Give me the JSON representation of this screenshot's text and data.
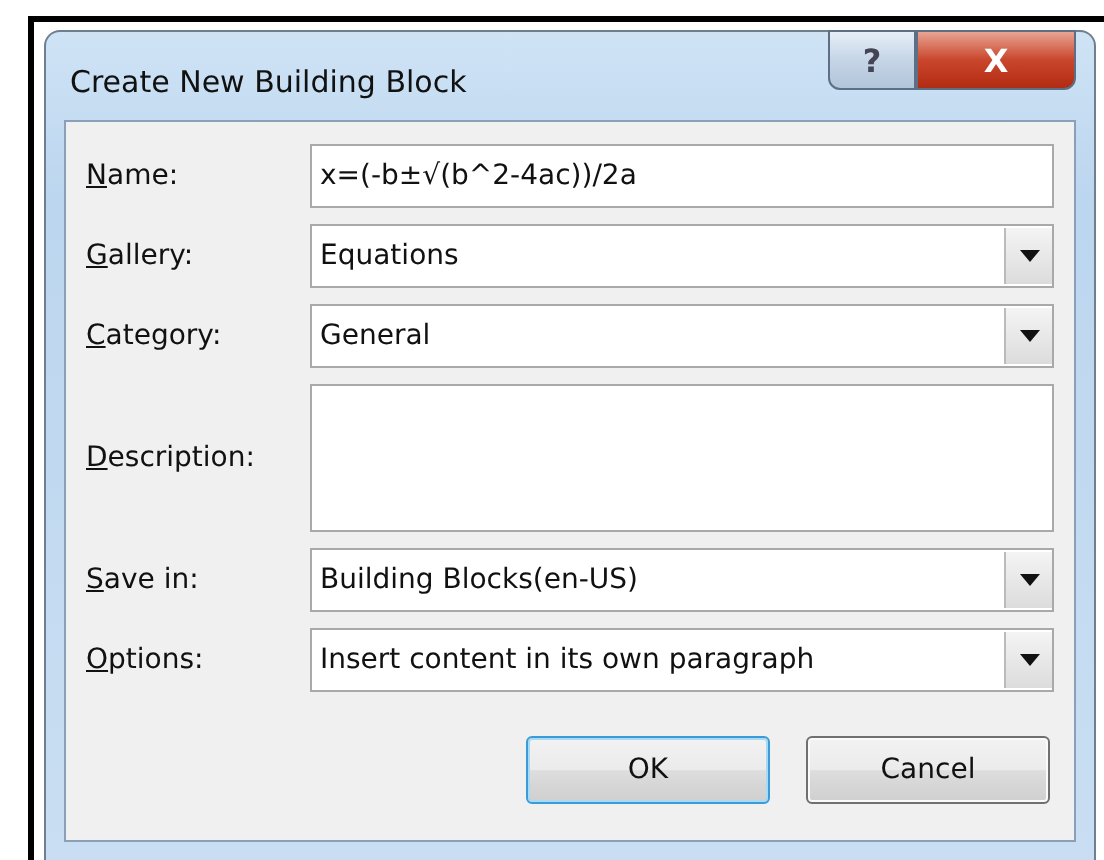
{
  "window": {
    "title": "Create New Building Block",
    "help": "?",
    "close": "X"
  },
  "fields": [
    {
      "label": "Name:",
      "kind": "text",
      "value": "x=(-b±√(b^2-4ac))/2a"
    },
    {
      "label": "Gallery:",
      "kind": "dropdown",
      "value": "Equations"
    },
    {
      "label": "Category:",
      "kind": "dropdown",
      "value": "General"
    },
    {
      "label": "Description:",
      "kind": "textarea"
    },
    {
      "label": "Save in:",
      "kind": "dropdown",
      "value": "Building Blocks(en-US)"
    },
    {
      "label": "Options:",
      "kind": "dropdown",
      "value": "Insert content in its own paragraph"
    }
  ],
  "buttons": [
    {
      "label": "OK",
      "default": true
    },
    {
      "label": "Cancel",
      "default": false
    }
  ]
}
